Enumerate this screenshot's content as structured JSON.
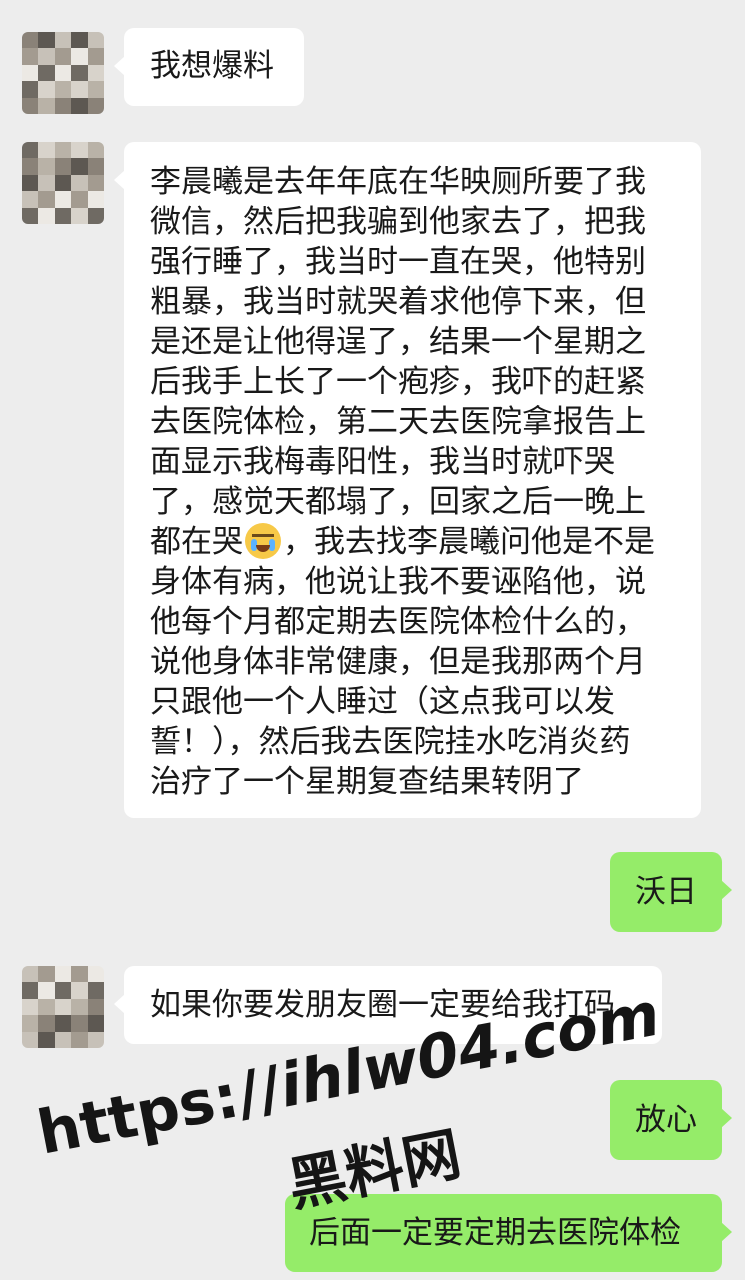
{
  "colors": {
    "background": "#ededed",
    "incoming_bubble": "#ffffff",
    "outgoing_bubble": "#95ec69",
    "text": "#191919"
  },
  "messages": [
    {
      "id": "m1",
      "direction": "incoming",
      "text": "我想爆料"
    },
    {
      "id": "m2",
      "direction": "incoming",
      "lines": [
        "李晨曦是去年年底在华映厕所要了我",
        "微信，然后把我骗到他家去了，把我",
        "强行睡了，我当时一直在哭，他特别",
        "粗暴，我当时就哭着求他停下来，但",
        "是还是让他得逞了，结果一个星期之",
        "后我手上长了一个疱疹，我吓的赶紧",
        "去医院体检，第二天去医院拿报告上",
        "面显示我梅毒阳性，我当时就吓哭",
        "了，感觉天都塌了，回家之后一晚上"
      ],
      "line_before_emoji": "都在哭",
      "emoji": "crying-face-emoji",
      "line_after_emoji": "，我去找李晨曦问他是不是",
      "lines_end": [
        "身体有病，他说让我不要诬陷他，说",
        "他每个月都定期去医院体检什么的，",
        "说他身体非常健康，但是我那两个月",
        "只跟他一个人睡过（这点我可以发",
        "誓！），然后我去医院挂水吃消炎药",
        "治疗了一个星期复查结果转阴了"
      ]
    },
    {
      "id": "m3",
      "direction": "outgoing",
      "text": "沃日"
    },
    {
      "id": "m4",
      "direction": "incoming",
      "text": "如果你要发朋友圈一定要给我打码"
    },
    {
      "id": "m5",
      "direction": "outgoing",
      "text": "放心"
    },
    {
      "id": "m6",
      "direction": "outgoing",
      "text": "后面一定要定期去医院体检"
    }
  ],
  "watermark": {
    "url": "https://ihlw04.com",
    "url_part1": "https://",
    "url_part2": "ihlw04.com",
    "name": "黑料网"
  }
}
